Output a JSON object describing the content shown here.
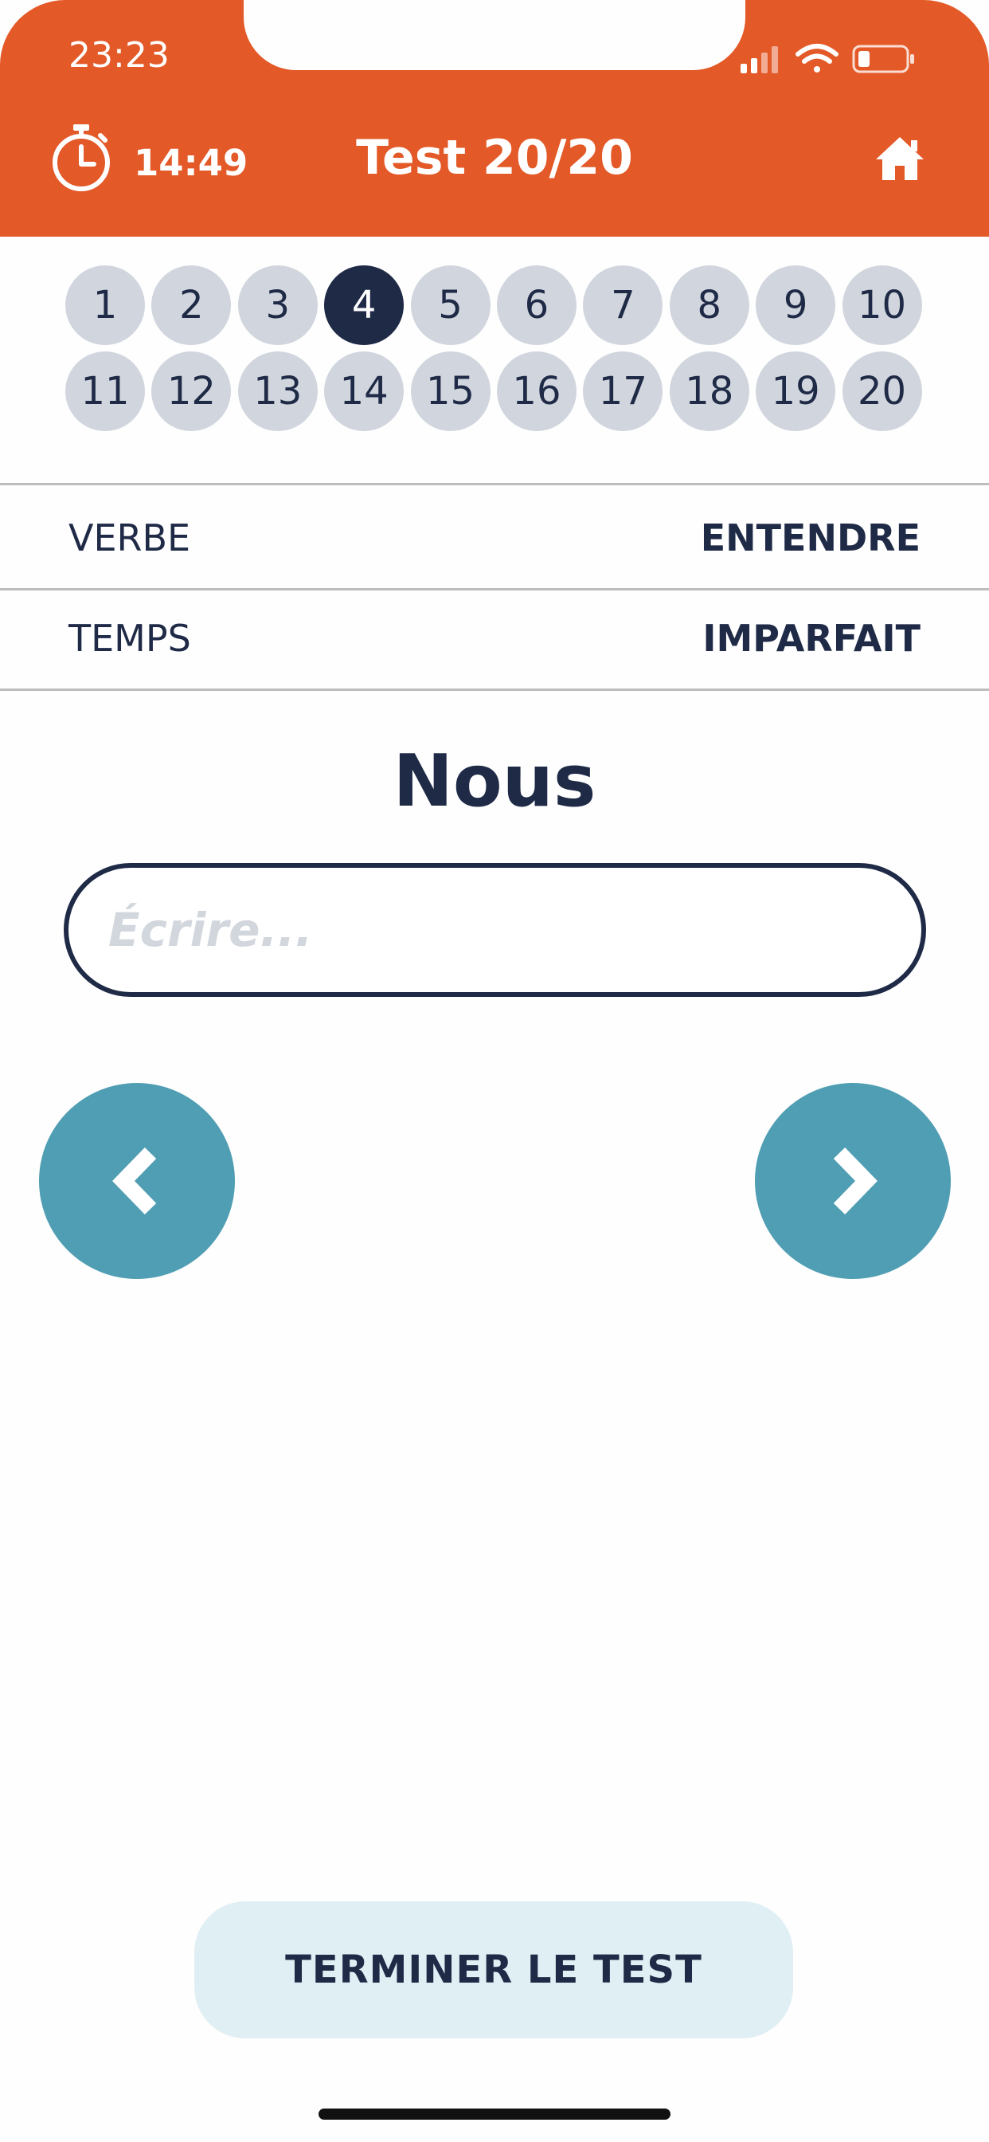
{
  "status_bar": {
    "time": "23:23"
  },
  "header": {
    "timer": "14:49",
    "title": "Test 20/20",
    "icons": {
      "timer": "stopwatch-icon",
      "home": "home-icon"
    }
  },
  "questions": {
    "numbers": [
      "1",
      "2",
      "3",
      "4",
      "5",
      "6",
      "7",
      "8",
      "9",
      "10",
      "11",
      "12",
      "13",
      "14",
      "15",
      "16",
      "17",
      "18",
      "19",
      "20"
    ],
    "current": "4"
  },
  "info": {
    "verb_label": "VERBE",
    "verb_value": "ENTENDRE",
    "tense_label": "TEMPS",
    "tense_value": "IMPARFAIT"
  },
  "exercise": {
    "pronoun": "Nous",
    "answer_value": "",
    "answer_placeholder": "Écrire..."
  },
  "nav": {
    "prev_icon": "chevron-left-icon",
    "next_icon": "chevron-right-icon"
  },
  "footer": {
    "finish_label": "TERMINER LE TEST"
  },
  "colors": {
    "header": "#e35927",
    "navy": "#1f2a47",
    "teal": "#509eb3",
    "chip": "#d1d6de",
    "finish_bg": "#e0eff4"
  }
}
